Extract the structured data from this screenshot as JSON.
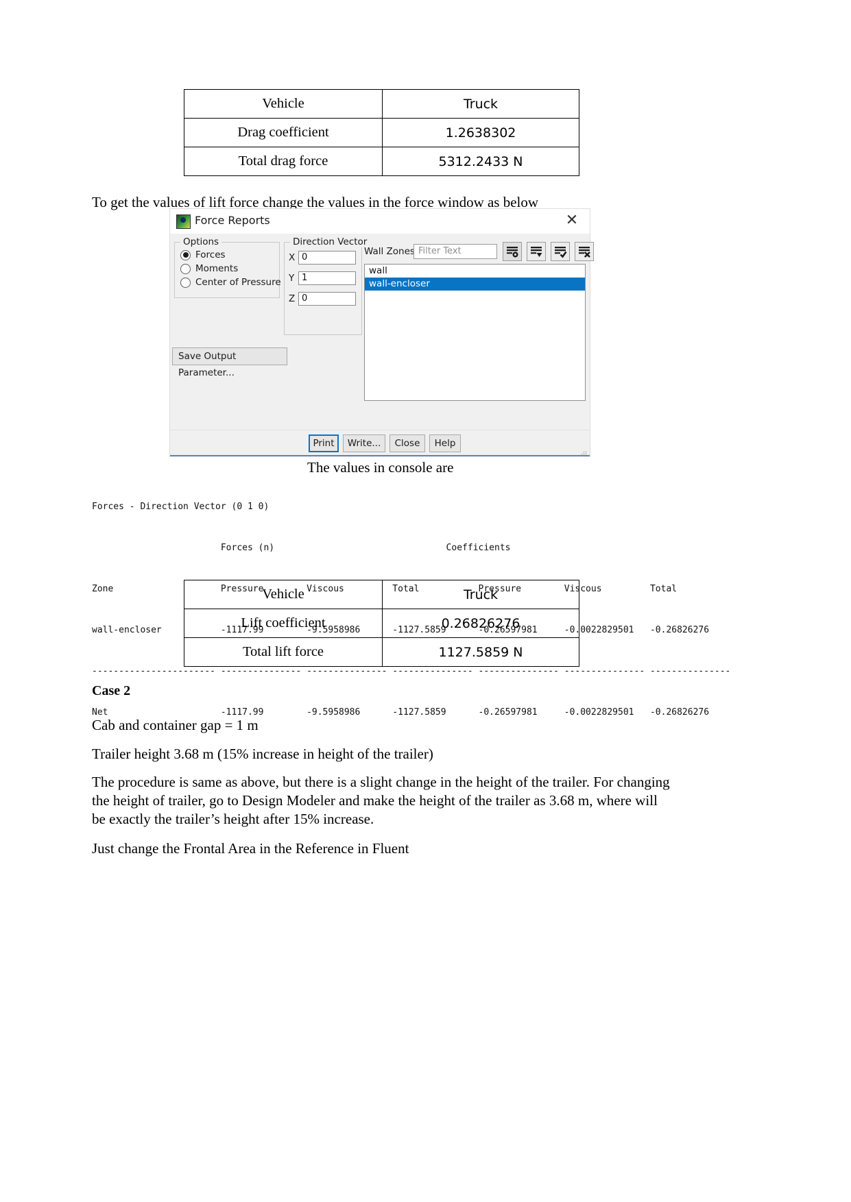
{
  "document": {
    "intro_text": "To get the values of lift force change the values in the force window as below",
    "console_caption": "The values in console are",
    "case_heading": "Case 2",
    "gap_text": "Cab and container gap = 1 m",
    "height_text": "Trailer height 3.68 m (15% increase in height of the trailer)",
    "procedure_text": "The procedure is same as above, but there is a slight change in the height of the trailer. For changing the height of trailer, go to Design Modeler and make the height of the trailer as 3.68 m, where will be exactly the trailer’s height after 15% increase.",
    "frontal_text": "Just change the Frontal Area in the Reference in Fluent"
  },
  "drag_table": {
    "rows": [
      {
        "label": "Vehicle",
        "value": "Truck"
      },
      {
        "label": "Drag coefficient",
        "value": "1.2638302"
      },
      {
        "label": "Total drag force",
        "value": "5312.2433 N"
      }
    ]
  },
  "lift_table": {
    "rows": [
      {
        "label": "Vehicle",
        "value": "Truck"
      },
      {
        "label": "Lift coefficient",
        "value": "0.26826276"
      },
      {
        "label": "Total lift force",
        "value": "1127.5859 N"
      }
    ]
  },
  "force_dialog": {
    "title": "Force Reports",
    "close_label": "✕",
    "options": {
      "group_title": "Options",
      "items": [
        {
          "label": "Forces",
          "selected": true
        },
        {
          "label": "Moments",
          "selected": false
        },
        {
          "label": "Center of Pressure",
          "selected": false
        }
      ]
    },
    "direction_vector": {
      "group_title": "Direction Vector",
      "x_label": "X",
      "x_value": "0",
      "y_label": "Y",
      "y_value": "1",
      "z_label": "Z",
      "z_value": "0"
    },
    "save_output_label": "Save Output Parameter...",
    "wall_zones": {
      "label": "Wall Zones",
      "filter_placeholder": "Filter Text",
      "filter_value": "",
      "icons": [
        "list-select-icon",
        "list-dropdown-icon",
        "list-check-all-icon",
        "list-deselect-all-icon"
      ],
      "items": [
        {
          "name": "wall",
          "selected": false
        },
        {
          "name": "wall-encloser",
          "selected": true
        }
      ]
    },
    "buttons": {
      "print": "Print",
      "write": "Write...",
      "close": "Close",
      "help": "Help"
    }
  },
  "console": {
    "lines": [
      "Forces - Direction Vector (0 1 0)",
      "                        Forces (n)                                Coefficients",
      "Zone                    Pressure        Viscous         Total           Pressure        Viscous         Total",
      "wall-encloser           -1117.99        -9.5958986      -1127.5859      -0.26597981     -0.0022829501   -0.26826276",
      "----------------------- --------------- --------------- --------------- --------------- --------------- ---------------",
      "Net                     -1117.99        -9.5958986      -1127.5859      -0.26597981     -0.0022829501   -0.26826276"
    ]
  }
}
